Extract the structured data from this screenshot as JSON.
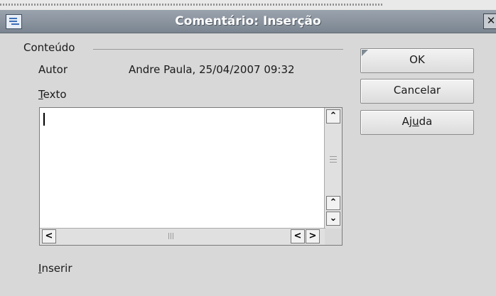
{
  "window": {
    "title": "Comentário: Inserção"
  },
  "content": {
    "group_label": "Conteúdo",
    "author_label": "Autor",
    "author_value": "Andre Paula, 25/04/2007 09:32",
    "text_label_prefix": "",
    "text_label_mnemonic": "T",
    "text_label_rest": "exto",
    "text_value": "",
    "insert_label_mnemonic": "I",
    "insert_label_rest": "nserir"
  },
  "buttons": {
    "ok": "OK",
    "cancel": "Cancelar",
    "help_prefix": "Aj",
    "help_mnemonic": "u",
    "help_rest": "da"
  },
  "icons": {
    "app": "document-icon",
    "close": "close-icon",
    "scroll_up": "arrow-up-icon",
    "scroll_down": "arrow-down-icon",
    "scroll_left": "arrow-left-icon",
    "scroll_right": "arrow-right-icon"
  },
  "colors": {
    "titlebar": "#7b8591",
    "dialog_bg": "#d8d8d8",
    "textarea_bg": "#ffffff"
  }
}
